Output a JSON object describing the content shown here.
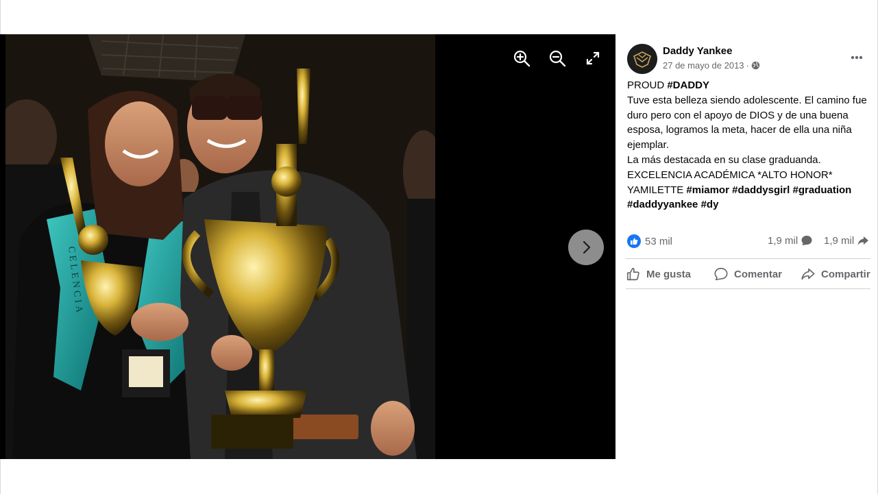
{
  "viewer": {
    "tools": [
      {
        "icon": "zoom-in-icon"
      },
      {
        "icon": "zoom-out-icon"
      },
      {
        "icon": "fullscreen-icon"
      }
    ],
    "next_icon": "chevron-right-icon",
    "photo_stole_text": "CELENCIA"
  },
  "post": {
    "author": "Daddy Yankee",
    "date": "27 de mayo de 2013",
    "separator": "·",
    "privacy_icon": "globe-icon",
    "line1_plain": "PROUD ",
    "line1_tag": "#DADDY",
    "line2": "Tuve esta belleza siendo adolescente. El camino fue duro pero con el apoyo de DIOS y de una buena esposa, logramos la meta, hacer de ella una niña ejemplar.",
    "line3": "La más destacada en su clase graduanda.",
    "line4": "EXCELENCIA ACADÉMICA *ALTO HONOR*",
    "line5_plain": "YAMILETTE ",
    "hashtags": [
      "#miamor",
      "#daddysgirl",
      "#graduation",
      "#daddyyankee",
      "#dy"
    ]
  },
  "stats": {
    "reactions": "53 mil",
    "comments": "1,9 mil",
    "shares": "1,9 mil"
  },
  "actions": {
    "like": "Me gusta",
    "comment": "Comentar",
    "share": "Compartir"
  },
  "colors": {
    "like_blue": "#1877f2",
    "muted_text": "#65676b",
    "viewer_bg": "#000000"
  }
}
